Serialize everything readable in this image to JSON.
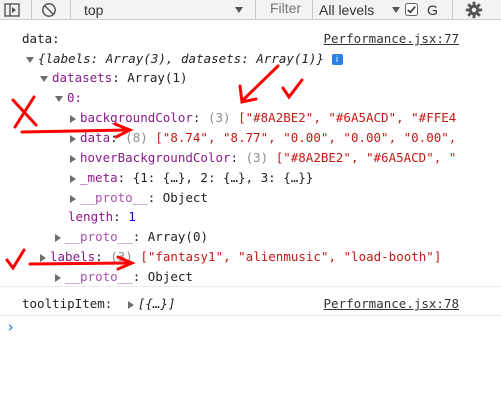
{
  "toolbar": {
    "context": "top",
    "filter_placeholder": "Filter",
    "levels": "All levels",
    "group_label": "G"
  },
  "console": {
    "data_label": "data:",
    "data_source": "Performance.jsx:77",
    "summary": "{labels: Array(3), datasets: Array(1)}",
    "datasets_key": "datasets",
    "datasets_val": ": Array(1)",
    "index0": "0:",
    "bg_key": "backgroundColor",
    "bg_count": "(3)",
    "bg_values": "[\"#8A2BE2\", \"#6A5ACD\", \"#FFE4",
    "data_key": "data",
    "data_count": "(8)",
    "data_values": "[\"8.74\", \"8.77\", \"0.00\", \"0.00\", \"0.00\",",
    "hover_key": "hoverBackgroundColor",
    "hover_count": "(3)",
    "hover_values": "[\"#8A2BE2\", \"#6A5ACD\", \"",
    "meta_key": "_meta",
    "meta_values": ": {1: {…}, 2: {…}, 3: {…}}",
    "proto_key": "__proto__",
    "proto_obj": ": Object",
    "length_key": "length",
    "length_val": "1",
    "proto_array": ": Array(0)",
    "labels_key": "labels",
    "labels_count": "(3)",
    "labels_values": "[\"fantasy1\", \"alienmusic\", \"load-booth\"]",
    "proto_obj2": ": Object",
    "tooltip_label": "tooltipItem:",
    "tooltip_value": "[{…}]",
    "tooltip_source": "Performance.jsx:78"
  },
  "annotation_colors": {
    "red": "#ff0000"
  }
}
